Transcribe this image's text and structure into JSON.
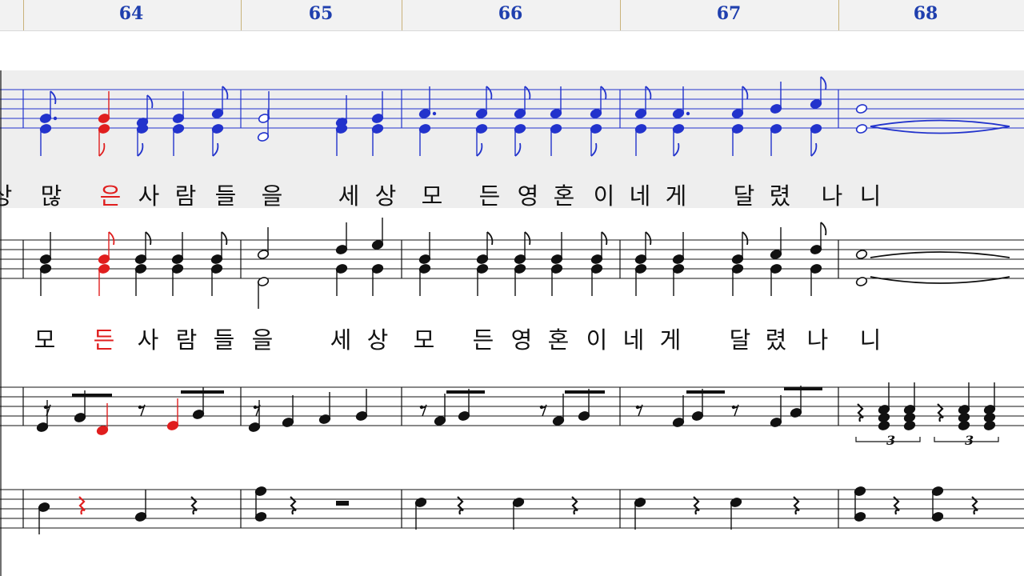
{
  "ruler": {
    "measures": [
      "64",
      "65",
      "66",
      "67",
      "68"
    ]
  },
  "colors": {
    "highlight_note": "#e01e1e",
    "active_staff": "#2233cc",
    "ink": "#111111",
    "measure_numbers": "#1f3fae"
  },
  "lyrics": {
    "line1": [
      "상",
      "많",
      "은",
      "사",
      "람",
      "들",
      "을",
      "세",
      "상",
      "모",
      "든",
      "영",
      "혼",
      "이",
      "네",
      "게",
      "달",
      "렸",
      "나",
      "니"
    ],
    "line1_active_index": 2,
    "line2": [
      "모",
      "든",
      "사",
      "람",
      "들",
      "을",
      "세",
      "상",
      "모",
      "든",
      "영",
      "혼",
      "이",
      "네",
      "게",
      "달",
      "렸",
      "나",
      "니"
    ],
    "line2_active_index": 1
  },
  "triplet_marks": [
    "3",
    "3"
  ]
}
